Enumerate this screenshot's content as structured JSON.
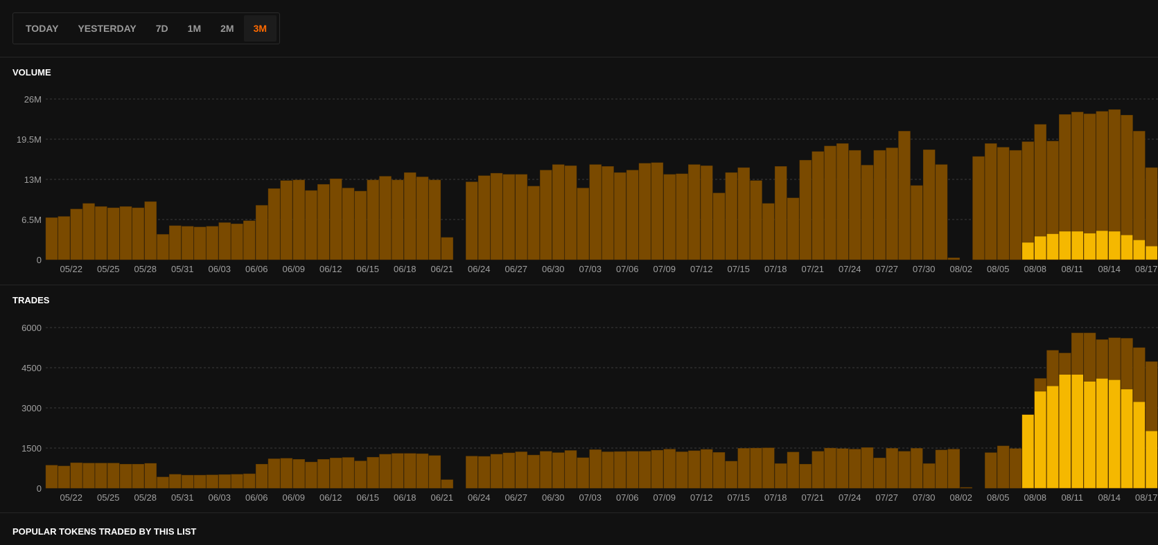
{
  "range_tabs": [
    {
      "label": "TODAY",
      "active": false
    },
    {
      "label": "YESTERDAY",
      "active": false
    },
    {
      "label": "7D",
      "active": false
    },
    {
      "label": "1M",
      "active": false
    },
    {
      "label": "2M",
      "active": false
    },
    {
      "label": "3M",
      "active": true
    }
  ],
  "sections": {
    "volume_title": "VOLUME",
    "trades_title": "TRADES",
    "popular_title": "POPULAR TOKENS TRADED BY THIS LIST"
  },
  "colors": {
    "series_total": "#7a4a00",
    "series_highlight": "#f5b800",
    "active_tab": "#ff6a00",
    "grid": "#3a3a3a"
  },
  "chart_data": [
    {
      "type": "bar",
      "id": "volume",
      "title": "VOLUME",
      "stacked": true,
      "ylim": [
        0,
        26000000
      ],
      "y_ticks": [
        0,
        6500000,
        13000000,
        19500000,
        26000000
      ],
      "y_tick_labels": [
        "0",
        "6.5M",
        "13M",
        "19.5M",
        "26M"
      ],
      "x_tick_labels": [
        "05/22",
        "05/25",
        "05/28",
        "05/31",
        "06/03",
        "06/06",
        "06/09",
        "06/12",
        "06/15",
        "06/18",
        "06/21",
        "06/24",
        "06/27",
        "06/30",
        "07/03",
        "07/06",
        "07/09",
        "07/12",
        "07/15",
        "07/18",
        "07/21",
        "07/24",
        "07/27",
        "07/30",
        "08/02",
        "08/05",
        "08/08",
        "08/11",
        "08/14",
        "08/17"
      ],
      "grid": true,
      "series": [
        {
          "color": "#7a4a00",
          "values": [
            6.8,
            7.0,
            8.2,
            9.1,
            8.6,
            8.4,
            8.6,
            8.4,
            9.4,
            4.1,
            5.5,
            5.4,
            5.3,
            5.4,
            6.0,
            5.8,
            6.3,
            8.8,
            11.5,
            12.8,
            12.9,
            11.2,
            12.2,
            13.1,
            11.6,
            11.1,
            12.9,
            13.5,
            12.9,
            14.1,
            13.4,
            12.9,
            3.6,
            0,
            12.6,
            13.6,
            14.0,
            13.8,
            13.8,
            11.9,
            14.5,
            15.4,
            15.2,
            11.6,
            15.4,
            15.1,
            14.1,
            14.5,
            15.6,
            15.7,
            13.8,
            13.9,
            15.4,
            15.2,
            10.8,
            14.1,
            14.9,
            12.8,
            9.1,
            15.1,
            10.0,
            16.1,
            17.5,
            18.4,
            18.8,
            17.7,
            15.3,
            17.7,
            18.1,
            20.8,
            12.0,
            17.8,
            15.4,
            0.3,
            0,
            16.7,
            18.8,
            18.2,
            17.7,
            19.1,
            21.9,
            19.2,
            23.5,
            23.9,
            23.6,
            24.0,
            24.3,
            23.4,
            20.8,
            14.9
          ]
        },
        {
          "color": "#f5b800",
          "values": [
            0,
            0,
            0,
            0,
            0,
            0,
            0,
            0,
            0,
            0,
            0,
            0,
            0,
            0,
            0,
            0,
            0,
            0,
            0,
            0,
            0,
            0,
            0,
            0,
            0,
            0,
            0,
            0,
            0,
            0,
            0,
            0,
            0,
            0,
            0,
            0,
            0,
            0,
            0,
            0,
            0,
            0,
            0,
            0,
            0,
            0,
            0,
            0,
            0,
            0,
            0,
            0,
            0,
            0,
            0,
            0,
            0,
            0,
            0,
            0,
            0,
            0,
            0,
            0,
            0,
            0,
            0,
            0,
            0,
            0,
            0,
            0,
            0,
            0,
            0,
            0,
            0,
            0,
            0,
            2.8,
            3.8,
            4.2,
            4.6,
            4.6,
            4.3,
            4.7,
            4.6,
            4.0,
            3.2,
            2.2
          ]
        }
      ],
      "value_scale": 1000000
    },
    {
      "type": "bar",
      "id": "trades",
      "title": "TRADES",
      "stacked": true,
      "ylim": [
        0,
        6000
      ],
      "y_ticks": [
        0,
        1500,
        3000,
        4500,
        6000
      ],
      "y_tick_labels": [
        "0",
        "1500",
        "3000",
        "4500",
        "6000"
      ],
      "x_tick_labels": [
        "05/22",
        "05/25",
        "05/28",
        "05/31",
        "06/03",
        "06/06",
        "06/09",
        "06/12",
        "06/15",
        "06/18",
        "06/21",
        "06/24",
        "06/27",
        "06/30",
        "07/03",
        "07/06",
        "07/09",
        "07/12",
        "07/15",
        "07/18",
        "07/21",
        "07/24",
        "07/27",
        "07/30",
        "08/02",
        "08/05",
        "08/08",
        "08/11",
        "08/14",
        "08/17"
      ],
      "grid": true,
      "series": [
        {
          "color": "#7a4a00",
          "values": [
            860,
            830,
            950,
            940,
            940,
            940,
            900,
            900,
            930,
            420,
            520,
            490,
            490,
            500,
            510,
            520,
            540,
            900,
            1100,
            1120,
            1080,
            980,
            1080,
            1130,
            1150,
            1020,
            1160,
            1270,
            1300,
            1300,
            1290,
            1220,
            320,
            0,
            1200,
            1190,
            1270,
            1320,
            1360,
            1240,
            1380,
            1330,
            1410,
            1140,
            1440,
            1360,
            1370,
            1380,
            1380,
            1420,
            1460,
            1360,
            1400,
            1450,
            1340,
            1010,
            1490,
            1500,
            1510,
            920,
            1350,
            900,
            1380,
            1500,
            1480,
            1460,
            1520,
            1130,
            1490,
            1380,
            1490,
            920,
            1430,
            1460,
            30,
            0,
            1330,
            1580,
            1480,
            1480,
            4100,
            5150,
            5050,
            5800,
            5800,
            5550,
            5620,
            5600,
            5250,
            4730
          ]
        },
        {
          "color": "#f5b800",
          "values": [
            0,
            0,
            0,
            0,
            0,
            0,
            0,
            0,
            0,
            0,
            0,
            0,
            0,
            0,
            0,
            0,
            0,
            0,
            0,
            0,
            0,
            0,
            0,
            0,
            0,
            0,
            0,
            0,
            0,
            0,
            0,
            0,
            0,
            0,
            0,
            0,
            0,
            0,
            0,
            0,
            0,
            0,
            0,
            0,
            0,
            0,
            0,
            0,
            0,
            0,
            0,
            0,
            0,
            0,
            0,
            0,
            0,
            0,
            0,
            0,
            0,
            0,
            0,
            0,
            0,
            0,
            0,
            0,
            0,
            0,
            0,
            0,
            0,
            0,
            0,
            0,
            0,
            0,
            0,
            2750,
            3620,
            3820,
            4250,
            4250,
            3990,
            4100,
            4050,
            3700,
            3230,
            2140
          ]
        }
      ]
    }
  ]
}
